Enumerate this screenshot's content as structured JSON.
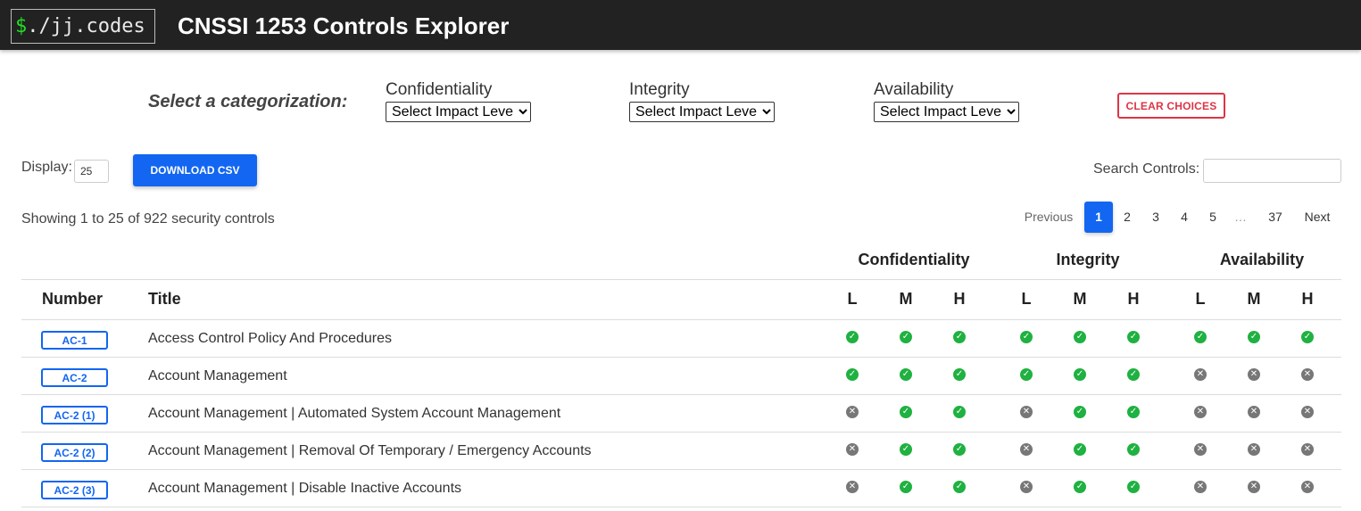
{
  "header": {
    "logo_prefix": "$",
    "logo_text": "./jj.codes",
    "title": "CNSSI 1253 Controls Explorer"
  },
  "categorization": {
    "label": "Select a categorization:",
    "groups": [
      {
        "title": "Confidentiality",
        "selected": "Select Impact Level"
      },
      {
        "title": "Integrity",
        "selected": "Select Impact Level"
      },
      {
        "title": "Availability",
        "selected": "Select Impact Level"
      }
    ],
    "clear_label": "Clear Choices"
  },
  "controls_bar": {
    "display_label": "Display:",
    "display_value": "25",
    "download_label": "Download CSV",
    "search_label": "Search Controls:",
    "search_value": ""
  },
  "info_text": "Showing 1 to 25 of 922 security controls",
  "pagination": {
    "previous": "Previous",
    "pages": [
      "1",
      "2",
      "3",
      "4",
      "5",
      "…",
      "37"
    ],
    "active": "1",
    "next": "Next"
  },
  "table": {
    "group_headers": [
      "Confidentiality",
      "Integrity",
      "Availability"
    ],
    "col_number": "Number",
    "col_title": "Title",
    "level_labels": [
      "L",
      "M",
      "H"
    ],
    "rows": [
      {
        "id": "AC-1",
        "title": "Access Control Policy And Procedures",
        "marks": [
          true,
          true,
          true,
          true,
          true,
          true,
          true,
          true,
          true
        ]
      },
      {
        "id": "AC-2",
        "title": "Account Management",
        "marks": [
          true,
          true,
          true,
          true,
          true,
          true,
          false,
          false,
          false
        ]
      },
      {
        "id": "AC-2 (1)",
        "title": "Account Management | Automated System Account Management",
        "marks": [
          false,
          true,
          true,
          false,
          true,
          true,
          false,
          false,
          false
        ]
      },
      {
        "id": "AC-2 (2)",
        "title": "Account Management | Removal Of Temporary / Emergency Accounts",
        "marks": [
          false,
          true,
          true,
          false,
          true,
          true,
          false,
          false,
          false
        ]
      },
      {
        "id": "AC-2 (3)",
        "title": "Account Management | Disable Inactive Accounts",
        "marks": [
          false,
          true,
          true,
          false,
          true,
          true,
          false,
          false,
          false
        ]
      }
    ]
  },
  "icons": {
    "included": "check-circle-icon",
    "excluded": "x-circle-icon"
  },
  "colors": {
    "primary": "#1266f1",
    "danger": "#dc3545",
    "included": "#1fb141",
    "excluded": "#777777",
    "topbar": "#222222"
  }
}
